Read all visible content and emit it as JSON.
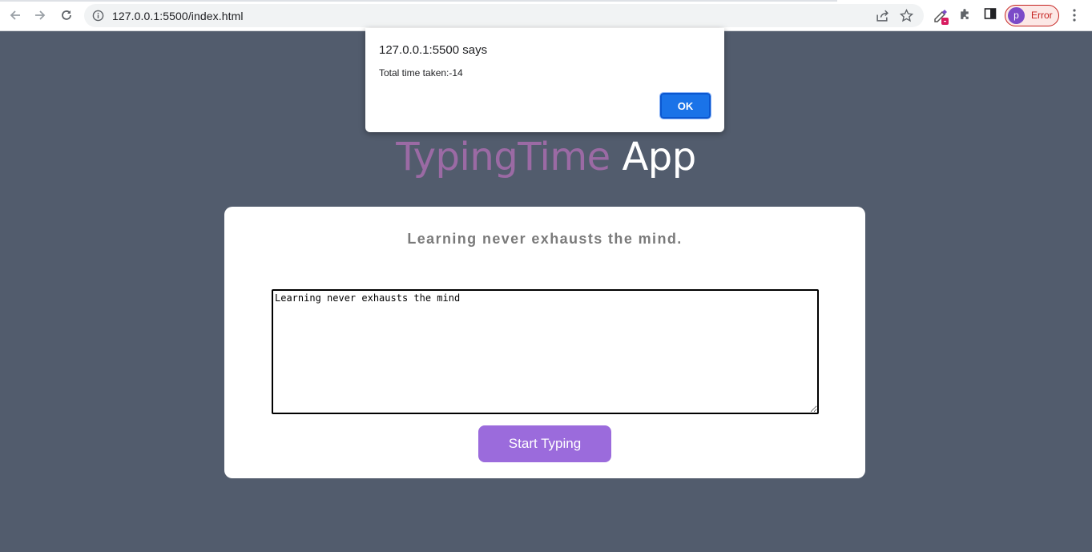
{
  "browser": {
    "url": "127.0.0.1:5500/index.html",
    "profile_initial": "p",
    "profile_status": "Error",
    "icons": [
      "back-icon",
      "forward-icon",
      "reload-icon",
      "info-icon",
      "share-icon",
      "star-icon",
      "eyedropper-extension-icon",
      "extensions-puzzle-icon",
      "side-panel-icon",
      "kebab-menu-icon"
    ]
  },
  "app": {
    "title_part1": "TypingTime",
    "title_part2": " App",
    "sentence": "Learning never exhausts the mind.",
    "typed_text": "Learning never exhausts the mind",
    "start_button_label": "Start Typing"
  },
  "alert": {
    "origin": "127.0.0.1:5500 says",
    "message": "Total time taken:-14",
    "ok_label": "OK"
  },
  "colors": {
    "page_background": "#525c6d",
    "title_accent": "#9b6aa4",
    "button": "#9b6bdc",
    "dialog_button": "#1a73e8"
  }
}
